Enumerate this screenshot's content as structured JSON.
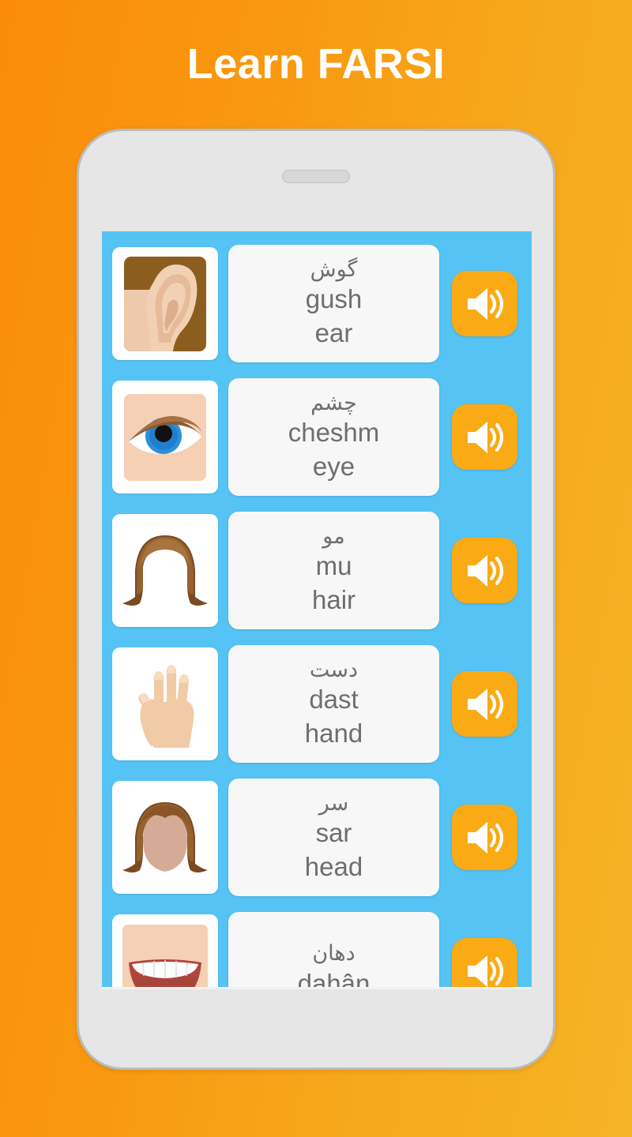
{
  "header": {
    "title": "Learn FARSI"
  },
  "colors": {
    "bg_gradient_start": "#fa8c0a",
    "bg_gradient_end": "#f5b426",
    "screen_background": "#55c4f5",
    "speaker_button": "#faaa14",
    "card_background": "#f7f7f7",
    "card_text": "#6e6e6e",
    "phone_body": "#e6e6e6",
    "phone_border": "#bcbcbc"
  },
  "phone": {
    "earpiece_name": "earpiece-speaker"
  },
  "screen": {
    "rows": [
      {
        "icon": "ear-icon",
        "native": "گوش",
        "transliteration": "gush",
        "english": "ear",
        "speaker_label": "play-audio"
      },
      {
        "icon": "eye-icon",
        "native": "چشم",
        "transliteration": "cheshm",
        "english": "eye",
        "speaker_label": "play-audio"
      },
      {
        "icon": "hair-icon",
        "native": "مو",
        "transliteration": "mu",
        "english": "hair",
        "speaker_label": "play-audio"
      },
      {
        "icon": "hand-icon",
        "native": "دست",
        "transliteration": "dast",
        "english": "hand",
        "speaker_label": "play-audio"
      },
      {
        "icon": "head-icon",
        "native": "سر",
        "transliteration": "sar",
        "english": "head",
        "speaker_label": "play-audio"
      },
      {
        "icon": "mouth-icon",
        "native": "دهان",
        "transliteration": "dahân",
        "english": "",
        "speaker_label": "play-audio"
      }
    ]
  }
}
